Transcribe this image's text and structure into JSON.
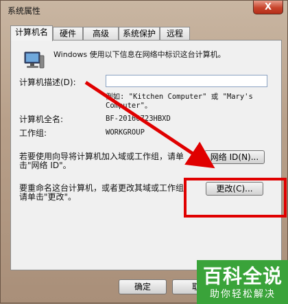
{
  "window": {
    "title": "系统属性",
    "close_label": "X"
  },
  "tabs": [
    {
      "label": "计算机名",
      "active": true
    },
    {
      "label": "硬件",
      "active": false
    },
    {
      "label": "高级",
      "active": false
    },
    {
      "label": "系统保护",
      "active": false
    },
    {
      "label": "远程",
      "active": false
    }
  ],
  "computer_name": {
    "intro": "Windows 使用以下信息在网络中标识这台计算机。",
    "description_label": "计算机描述(D):",
    "description_value": "",
    "example_line1": "例如: \"Kitchen Computer\" 或 \"Mary's",
    "example_line2": "Computer\"。",
    "full_name_label": "计算机全名:",
    "full_name_value": "BF-20160723HBXD",
    "workgroup_label": "工作组:",
    "workgroup_value": "WORKGROUP",
    "network_text_line1": "若要使用向导将计算机加入域或工作组，请单",
    "network_text_line2": "击\"网络 ID\"。",
    "network_id_button": "网络 ID(N)...",
    "rename_text_line1": "要重命名这台计算机，或者更改其域或工作组，",
    "rename_text_line2": "请单击\"更改\"。",
    "change_button": "更改(C)..."
  },
  "footer": {
    "ok_button": "确定",
    "cancel_button": "取"
  },
  "watermark": {
    "title": "百科全说",
    "subtitle": "助你轻松解决"
  },
  "colors": {
    "annotation_red": "#e00000",
    "watermark_green": "#3aa33a"
  }
}
